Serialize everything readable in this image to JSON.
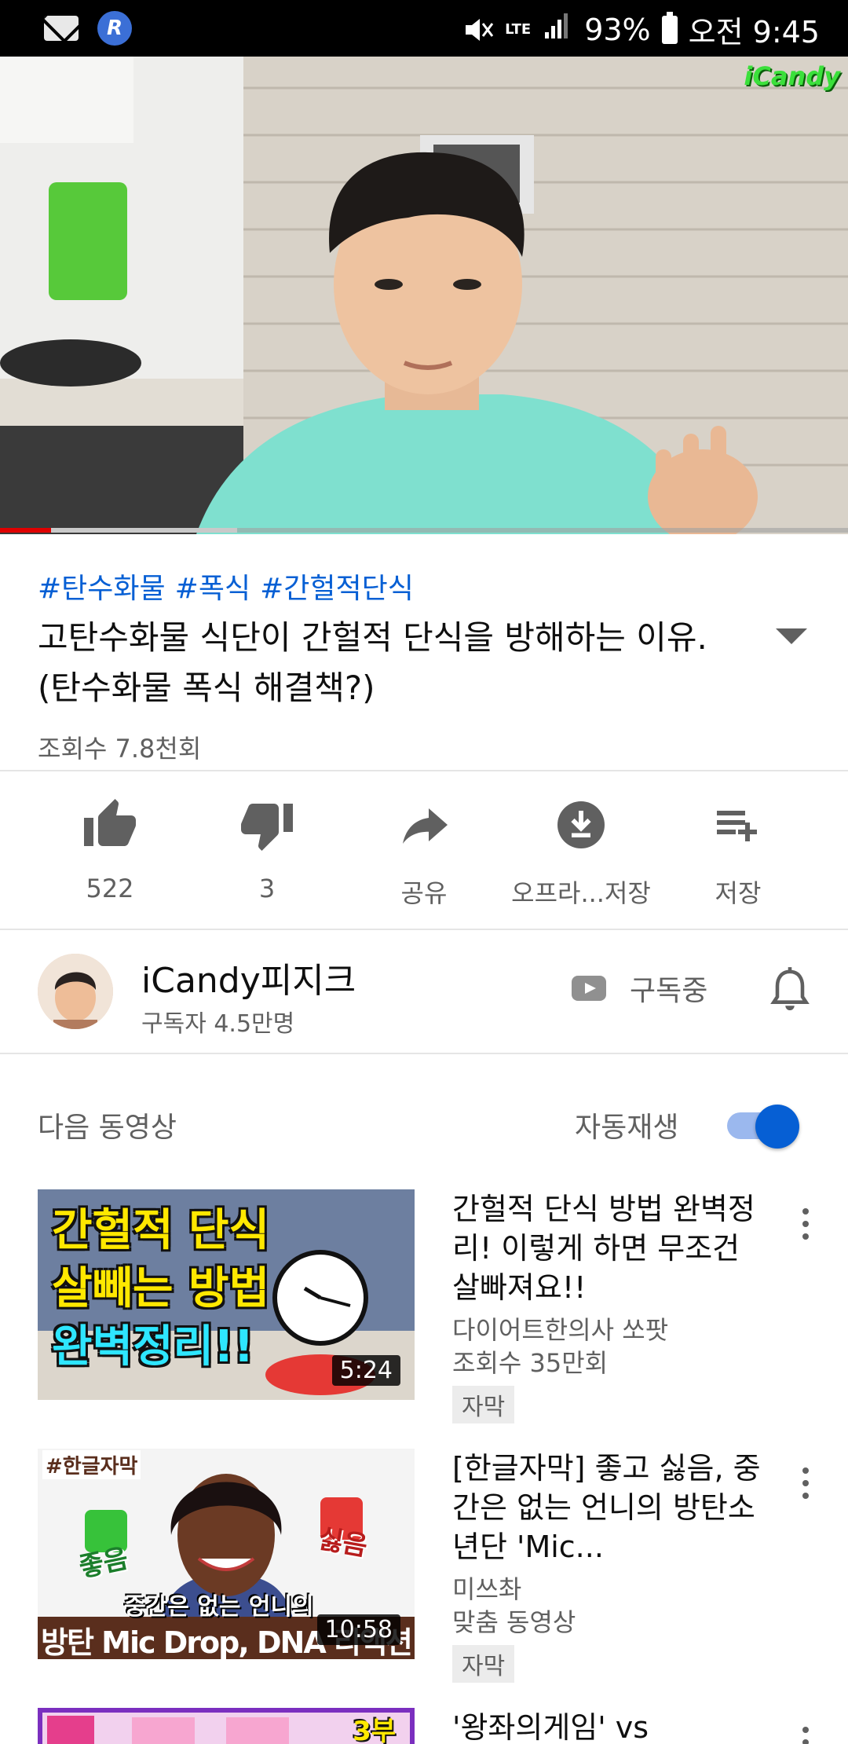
{
  "status_bar": {
    "battery": "93%",
    "time": "오전 9:45",
    "network": "LTE"
  },
  "player": {
    "watermark": "iCandy",
    "progress": 0.06,
    "buffered": 0.28
  },
  "video": {
    "hashtags": [
      "#탄수화물",
      "#폭식",
      "#간헐적단식"
    ],
    "title": "고탄수화물 식단이 간헐적 단식을 방해하는 이유. (탄수화물 폭식 해결책?)",
    "views": "조회수 7.8천회"
  },
  "actions": {
    "like": "522",
    "dislike": "3",
    "share": "공유",
    "offline": "오프라...저장",
    "save": "저장"
  },
  "channel": {
    "name": "iCandy피지크",
    "subscribers": "구독자 4.5만명",
    "subscribe_state": "구독중"
  },
  "up_next": {
    "label": "다음 동영상",
    "autoplay_label": "자동재생",
    "autoplay_on": true
  },
  "videos": [
    {
      "title": "간헐적 단식 방법 완벽정리! 이렇게 하면 무조건 살빠져요!!",
      "channel": "다이어트한의사 쏘팟",
      "meta": "조회수 35만회",
      "badge": "자막",
      "duration": "5:24",
      "thumb_text": [
        "간헐적 단식",
        "살빼는 방법",
        "완벽정리!!"
      ]
    },
    {
      "title": "[한글자막] 좋고 싫음, 중간은 없는 언니의 방탄소년단 'Mic...",
      "channel": "미쓰촤",
      "meta": "맞춤 동영상",
      "badge": "자막",
      "duration": "10:58",
      "thumb_text": [
        "#한글자막",
        "좋음",
        "싫음",
        "중간은 없는 언니의",
        "방탄 Mic Drop, DNA 리액션"
      ]
    },
    {
      "title": "'왕좌의게임' vs",
      "thumb_text": [
        "3부"
      ]
    }
  ]
}
